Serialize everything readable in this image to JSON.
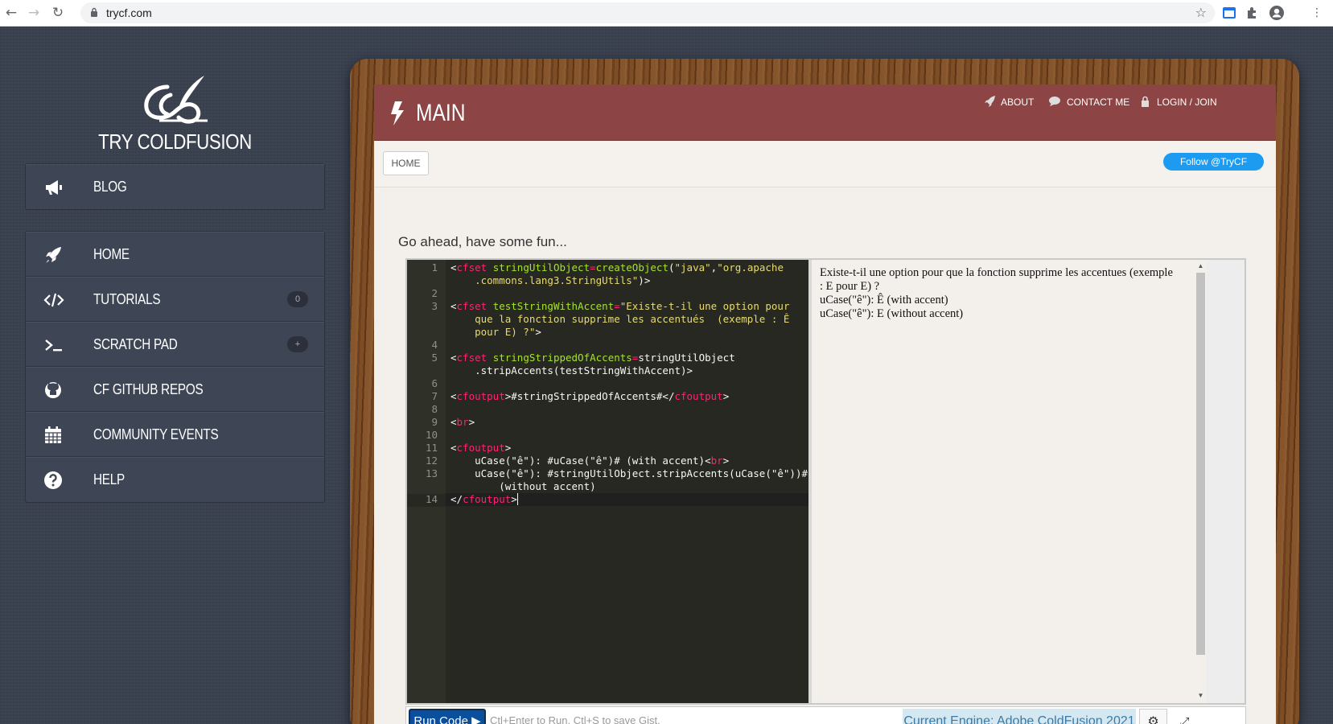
{
  "browser": {
    "url": "trycf.com",
    "back_icon": "back-arrow-icon",
    "forward_icon": "forward-arrow-icon",
    "reload_icon": "reload-icon"
  },
  "sidebar": {
    "site_title": "TRY COLDFUSION",
    "blog": {
      "label": "BLOG",
      "icon": "megaphone-icon"
    },
    "items": [
      {
        "label": "HOME",
        "icon": "rocket-icon",
        "badge": ""
      },
      {
        "label": "TUTORIALS",
        "icon": "code-icon",
        "badge": "0"
      },
      {
        "label": "SCRATCH PAD",
        "icon": "terminal-icon",
        "badge": "+"
      },
      {
        "label": "CF GITHUB REPOS",
        "icon": "github-icon",
        "badge": ""
      },
      {
        "label": "COMMUNITY EVENTS",
        "icon": "calendar-icon",
        "badge": ""
      },
      {
        "label": "HELP",
        "icon": "question-icon",
        "badge": ""
      }
    ]
  },
  "header": {
    "title": "MAIN",
    "links": {
      "about": "ABOUT",
      "contact": "CONTACT ME",
      "login": "LOGIN / JOIN"
    }
  },
  "subbar": {
    "home": "HOME",
    "follow": "Follow @TryCF"
  },
  "main": {
    "intro": "Go ahead, have some fun..."
  },
  "editor": {
    "line_numbers": [
      "1",
      "2",
      "3",
      "4",
      "5",
      "6",
      "7",
      "8",
      "9",
      "10",
      "11",
      "12",
      "13",
      "14"
    ],
    "output_lines": [
      "Existe-t-il une option pour que la fonction supprime les accentues (exemple",
      ": E pour E) ?",
      "uCase(\"ê\"): Ê (with accent)",
      "uCase(\"ê\"): E (without accent)"
    ]
  },
  "toolbar": {
    "run_label": "Run Code ▶",
    "hint": "Ctl+Enter to Run, Ctl+S to save Gist.",
    "engine": "Current Engine: Adobe ColdFusion 2021"
  },
  "colors": {
    "header_bg": "#8c4544",
    "sidebar_bg": "#3a414f",
    "run_btn": "#0a4f9e",
    "engine_bg": "#d4e8f2"
  }
}
